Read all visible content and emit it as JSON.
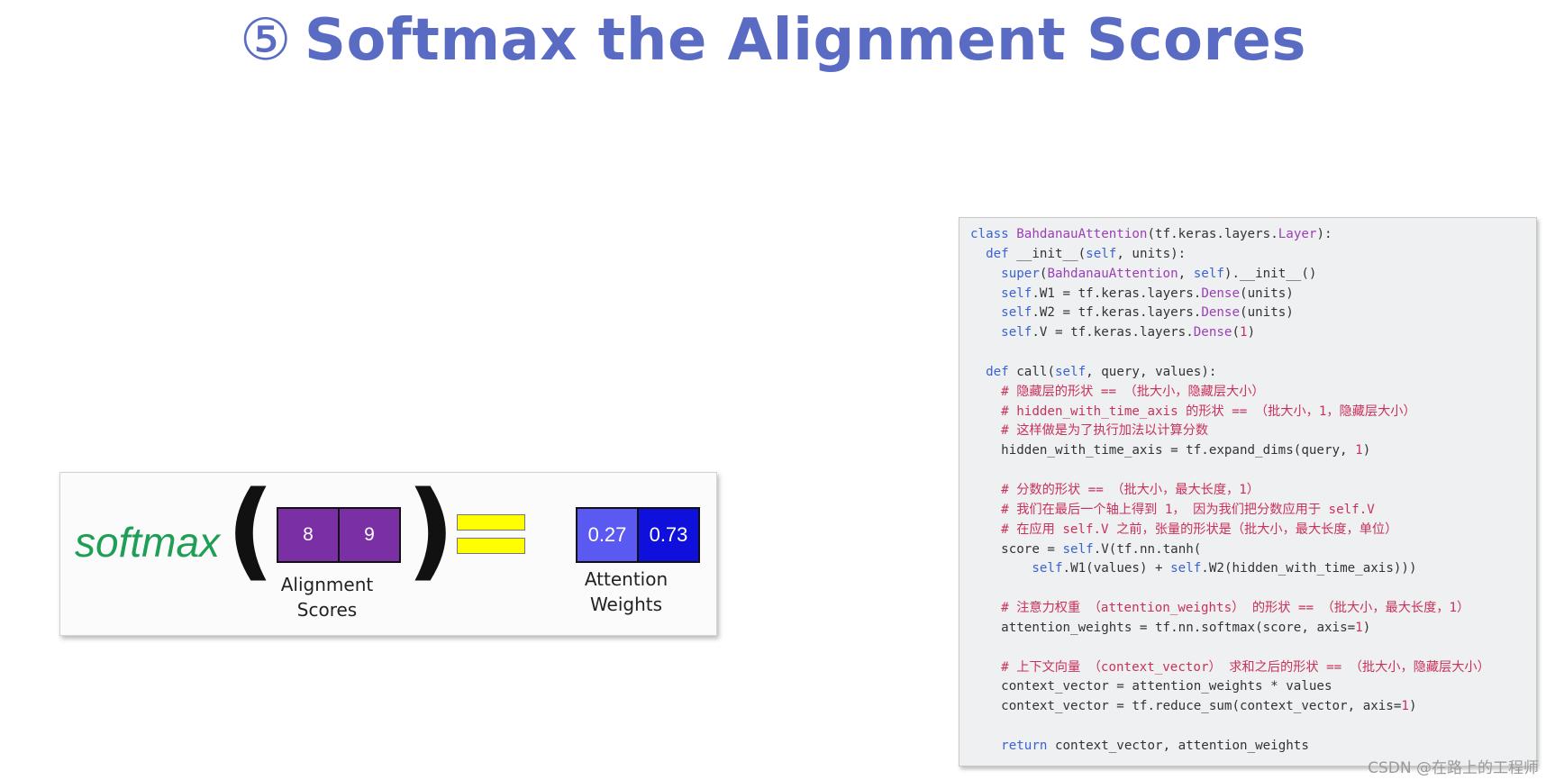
{
  "title": {
    "number": "⑤",
    "text": "Softmax the Alignment Scores"
  },
  "figure": {
    "function_word": "softmax",
    "left_paren": "(",
    "right_paren": ")",
    "alignment_scores": [
      "8",
      "9"
    ],
    "alignment_label_line1": "Alignment",
    "alignment_label_line2": "Scores",
    "attention_weights": [
      "0.27",
      "0.73"
    ],
    "attention_label_line1": "Attention",
    "attention_label_line2": "Weights",
    "colors": {
      "function_word": "#1f9e55",
      "score_cells": "#7b2fa5",
      "weight_cell_1": "#5a5af2",
      "weight_cell_2": "#1010dc",
      "equals_sign": "#ffff00"
    }
  },
  "code": {
    "lines": [
      "class BahdanauAttention(tf.keras.layers.Layer):",
      "  def __init__(self, units):",
      "    super(BahdanauAttention, self).__init__()",
      "    self.W1 = tf.keras.layers.Dense(units)",
      "    self.W2 = tf.keras.layers.Dense(units)",
      "    self.V = tf.keras.layers.Dense(1)",
      "",
      "  def call(self, query, values):",
      "    # 隐藏层的形状 == （批大小，隐藏层大小）",
      "    # hidden_with_time_axis 的形状 == （批大小，1，隐藏层大小）",
      "    # 这样做是为了执行加法以计算分数",
      "    hidden_with_time_axis = tf.expand_dims(query, 1)",
      "",
      "    # 分数的形状 == （批大小，最大长度，1）",
      "    # 我们在最后一个轴上得到 1， 因为我们把分数应用于 self.V",
      "    # 在应用 self.V 之前，张量的形状是（批大小，最大长度，单位）",
      "    score = self.V(tf.nn.tanh(",
      "        self.W1(values) + self.W2(hidden_with_time_axis)))",
      "",
      "    # 注意力权重 （attention_weights） 的形状 == （批大小，最大长度，1）",
      "    attention_weights = tf.nn.softmax(score, axis=1)",
      "",
      "    # 上下文向量 （context_vector） 求和之后的形状 == （批大小，隐藏层大小）",
      "    context_vector = attention_weights * values",
      "    context_vector = tf.reduce_sum(context_vector, axis=1)",
      "",
      "    return context_vector, attention_weights"
    ],
    "colors": {
      "keyword": "#3a63d0",
      "class_name": "#9b3fb5",
      "comment": "#c8325a",
      "number": "#c8325a",
      "plain": "#333333"
    }
  },
  "watermark": "CSDN @在路上的工程师"
}
